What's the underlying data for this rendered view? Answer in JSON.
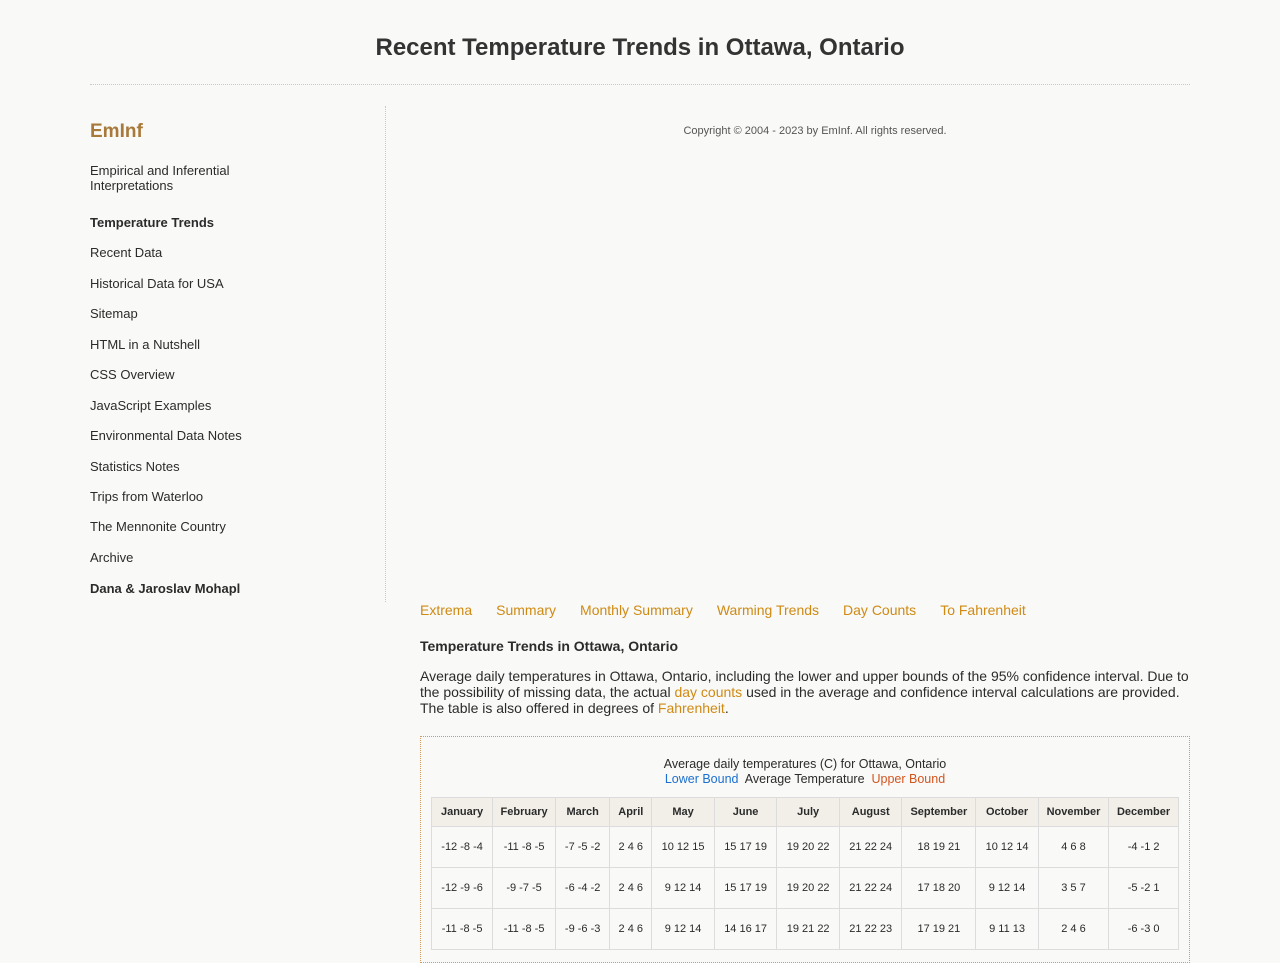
{
  "header": {
    "title": "Recent Temperature Trends in Ottawa, Ontario"
  },
  "sidebar": {
    "brand": "EmInf",
    "items": [
      {
        "label": "Empirical and Inferential Interpretations",
        "bold": false
      },
      {
        "label": "Temperature Trends",
        "bold": true
      },
      {
        "label": "Recent Data",
        "bold": false
      },
      {
        "label": "Historical Data for USA",
        "bold": false
      },
      {
        "label": "Sitemap",
        "bold": false
      },
      {
        "label": "HTML in a Nutshell",
        "bold": false
      },
      {
        "label": "CSS Overview",
        "bold": false
      },
      {
        "label": "JavaScript Examples",
        "bold": false
      },
      {
        "label": "Environmental Data Notes",
        "bold": false
      },
      {
        "label": "Statistics Notes",
        "bold": false
      },
      {
        "label": "Trips from Waterloo",
        "bold": false
      },
      {
        "label": "The Mennonite Country",
        "bold": false
      },
      {
        "label": "Archive",
        "bold": false
      },
      {
        "label": "Dana & Jaroslav Mohapl",
        "bold": true
      }
    ]
  },
  "main": {
    "copyright": "Copyright © 2004 - 2023 by EmInf. All rights reserved.",
    "tabs": [
      "Extrema",
      "Summary",
      "Monthly Summary",
      "Warming Trends",
      "Day Counts",
      "To Fahrenheit"
    ],
    "section_title": "Temperature Trends in Ottawa, Ontario",
    "intro": {
      "part1": "Average daily temperatures in Ottawa, Ontario, including the lower and upper bounds of the 95% confidence interval. Due to the possibility of missing data, the actual ",
      "link1": "day counts",
      "part2": " used in the average and confidence interval calculations are provided. The table is also offered in degrees of ",
      "link2": "Fahrenheit",
      "part3": "."
    },
    "table": {
      "caption": "Average daily temperatures (C) for Ottawa, Ontario",
      "legend_lower": "Lower Bound",
      "legend_avg": "Average Temperature",
      "legend_upper": "Upper Bound",
      "headers": [
        "January",
        "February",
        "March",
        "April",
        "May",
        "June",
        "July",
        "August",
        "September",
        "October",
        "November",
        "December"
      ],
      "rows": [
        [
          "-12 -8 -4",
          "-11 -8 -5",
          "-7 -5 -2",
          "2 4 6",
          "10 12 15",
          "15 17 19",
          "19 20 22",
          "21 22 24",
          "18 19 21",
          "10 12 14",
          "4 6 8",
          "-4 -1 2"
        ],
        [
          "-12 -9 -6",
          "-9 -7 -5",
          "-6 -4 -2",
          "2 4 6",
          "9 12 14",
          "15 17 19",
          "19 20 22",
          "21 22 24",
          "17 18 20",
          "9 12 14",
          "3 5 7",
          "-5 -2 1"
        ],
        [
          "-11 -8 -5",
          "-11 -8 -5",
          "-9 -6 -3",
          "2 4 6",
          "9 12 14",
          "14 16 17",
          "19 21 22",
          "21 22 23",
          "17 19 21",
          "9 11 13",
          "2 4 6",
          "-6 -3 0"
        ]
      ]
    }
  },
  "colors": {
    "brand": "#a8793a",
    "link": "#cf8a14",
    "lower_bound": "#1a6fd1",
    "upper_bound": "#d3541f"
  }
}
